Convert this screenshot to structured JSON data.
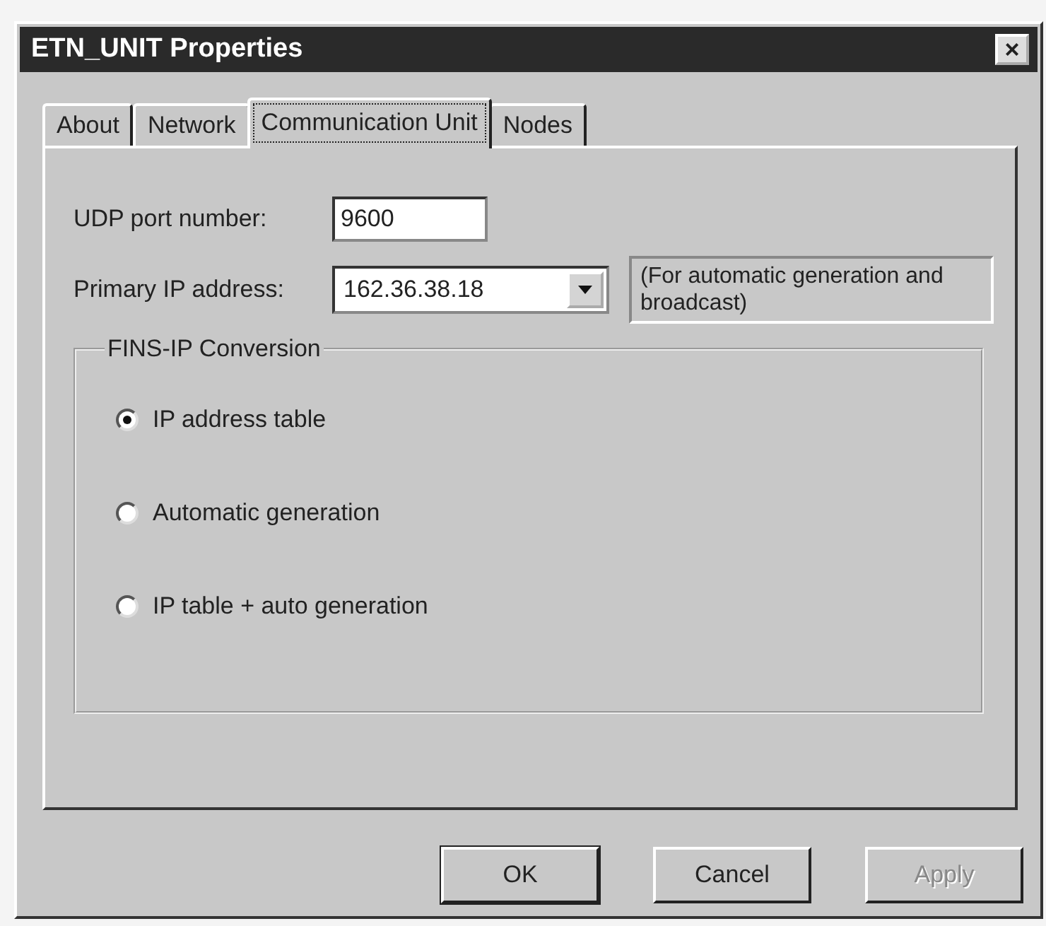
{
  "window": {
    "title": "ETN_UNIT Properties",
    "close": "×"
  },
  "tabs": [
    {
      "label": "About",
      "selected": false
    },
    {
      "label": "Network",
      "selected": false
    },
    {
      "label": "Communication Unit",
      "selected": true
    },
    {
      "label": "Nodes",
      "selected": false
    }
  ],
  "udp_port": {
    "label": "UDP port number:",
    "value": "9600"
  },
  "primary_ip": {
    "label": "Primary IP address:",
    "value": "162.36.38.18",
    "note": "(For automatic generation and broadcast)"
  },
  "fins_ip_conversion": {
    "title": "FINS-IP Conversion",
    "options": [
      {
        "label": "IP address table",
        "selected": true
      },
      {
        "label": "Automatic generation",
        "selected": false
      },
      {
        "label": "IP table + auto generation",
        "selected": false
      }
    ]
  },
  "buttons": [
    {
      "label": "OK",
      "disabled": false
    },
    {
      "label": "Cancel",
      "disabled": false
    },
    {
      "label": "Apply",
      "disabled": true
    }
  ]
}
